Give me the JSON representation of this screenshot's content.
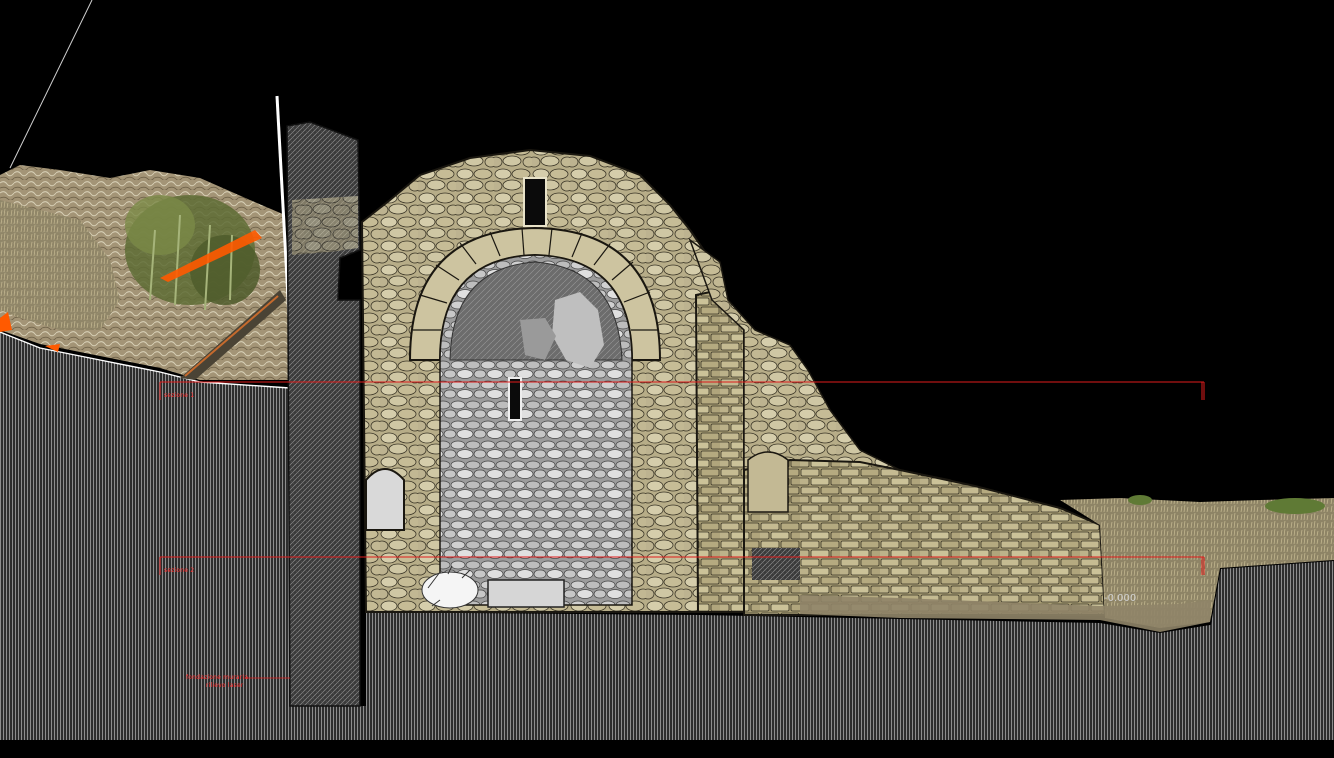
{
  "section_labels": {
    "cut_line_1": "sezione 1",
    "cut_line_2": "sezione 2",
    "elevation_mark": "-0.000",
    "note_line_1": "fondazione muraria",
    "note_line_2": "rilievo laser"
  },
  "colors": {
    "background": "#000000",
    "stone_light": "#d9d2b4",
    "stone_mid": "#b8ad86",
    "stone_dark": "#6f6649",
    "ground_hatch": "#8a8a8a",
    "cut_red": "#e01b1b",
    "vegetation": "#6d7a3c",
    "scan_orange": "#ff5a00"
  }
}
